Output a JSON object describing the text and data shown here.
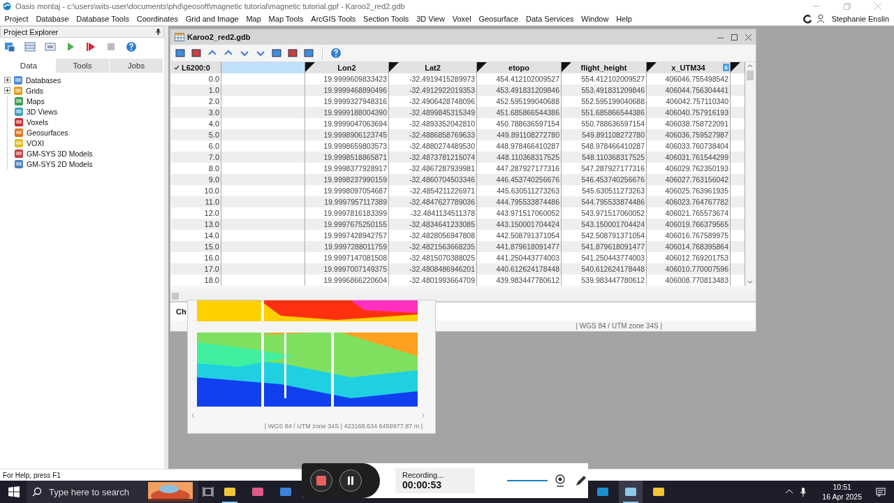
{
  "window": {
    "title": "Oasis montaj - c:\\users\\wits-user\\documents\\phd\\geosoft\\magnetic tutorial\\magnetic tutorial.gpf - Karoo2_red2.gdb"
  },
  "menu": [
    "Project",
    "Database",
    "Database Tools",
    "Coordinates",
    "Grid and Image",
    "Map",
    "Map Tools",
    "ArcGIS Tools",
    "Section Tools",
    "3D View",
    "Voxel",
    "Geosurface",
    "Data Services",
    "Window",
    "Help"
  ],
  "user": {
    "name": "Stephanie Enslin"
  },
  "explorer": {
    "title": "Project Explorer",
    "tabs": [
      {
        "label": "Data",
        "selected": true
      },
      {
        "label": "Tools",
        "selected": false
      },
      {
        "label": "Jobs",
        "selected": false
      }
    ],
    "items": [
      {
        "label": "Databases",
        "expandable": true
      },
      {
        "label": "Grids",
        "expandable": true
      },
      {
        "label": "Maps",
        "expandable": false
      },
      {
        "label": "3D Views",
        "expandable": false
      },
      {
        "label": "Voxels",
        "expandable": false
      },
      {
        "label": "Geosurfaces",
        "expandable": false
      },
      {
        "label": "VOXI",
        "expandable": false
      },
      {
        "label": "GM-SYS 3D Models",
        "expandable": false
      },
      {
        "label": "GM-SYS 2D Models",
        "expandable": false
      }
    ]
  },
  "database": {
    "title": "Karoo2_red2.gdb",
    "index_header": "L6200:0",
    "columns": [
      {
        "selected": true
      },
      {
        "label": "Lon2",
        "selected": false
      },
      {
        "label": "Lat2",
        "selected": false
      },
      {
        "label": "etopo",
        "selected": false
      },
      {
        "label": "flight_height",
        "selected": false
      },
      {
        "label": "x_UTM34",
        "selected": false
      }
    ],
    "rows": [
      {
        "index": "0.0",
        "values": [
          "19.9999609833423",
          "-32.4919415289973",
          "454.412102009527",
          "554.412102009527",
          "406046.755498542"
        ]
      },
      {
        "index": "1.0",
        "values": [
          "19.9999468890496",
          "-32.4912922019353",
          "453.491831209846",
          "553.491831209846",
          "406044.756304441"
        ]
      },
      {
        "index": "2.0",
        "values": [
          "19.9999327948316",
          "-32.4906428748096",
          "452.595199040688",
          "552.595199040688",
          "406042.757110340"
        ]
      },
      {
        "index": "3.0",
        "values": [
          "19.9999188004390",
          "-32.4899845315349",
          "451.685866544386",
          "551.685866544386",
          "406040.757916193"
        ]
      },
      {
        "index": "4.0",
        "values": [
          "19.9999047063694",
          "-32.4893352042810",
          "450.788636597154",
          "550.788636597154",
          "406038.758722091"
        ]
      },
      {
        "index": "5.0",
        "values": [
          "19.9998906123745",
          "-32.4886858769633",
          "449.891108272780",
          "549.891108272780",
          "406036.759527987"
        ]
      },
      {
        "index": "6.0",
        "values": [
          "19.9998659803573",
          "-32.4880274489530",
          "448.978466410287",
          "548.978466410287",
          "406033.760738404"
        ]
      },
      {
        "index": "7.0",
        "values": [
          "19.9998518865871",
          "-32.4873781215074",
          "448.110368317525",
          "548.110368317525",
          "406031.761544299"
        ]
      },
      {
        "index": "8.0",
        "values": [
          "19.9998377928917",
          "-32.4867287939981",
          "447.287927177316",
          "547.287927177316",
          "406029.762350193"
        ]
      },
      {
        "index": "9.0",
        "values": [
          "19.9998237990159",
          "-32.4860704503346",
          "446.453740256676",
          "546.453740256676",
          "406027.763156042"
        ]
      },
      {
        "index": "10.0",
        "values": [
          "19.9998097054687",
          "-32.4854211226971",
          "445.630511273263",
          "545.630511273263",
          "406025.763961935"
        ]
      },
      {
        "index": "11.0",
        "values": [
          "19.9997957117389",
          "-32.4847627789036",
          "444.795533874486",
          "544.795533874486",
          "406023.764767782"
        ]
      },
      {
        "index": "12.0",
        "values": [
          "19.9997816183399",
          "-32.4841134511378",
          "443.971517060052",
          "543.971517060052",
          "406021.765573674"
        ]
      },
      {
        "index": "13.0",
        "values": [
          "19.9997675250155",
          "-32.4834641233085",
          "443.150001704424",
          "543.150001704424",
          "406019.766379565"
        ]
      },
      {
        "index": "14.0",
        "values": [
          "19.9997428942757",
          "-32.4828056947808",
          "442.508791371054",
          "542.508791371054",
          "406016.767589975"
        ]
      },
      {
        "index": "15.0",
        "values": [
          "19.9997288011759",
          "-32.4821563668235",
          "441.879618091477",
          "541.879618091477",
          "406014.768395864"
        ]
      },
      {
        "index": "16.0",
        "values": [
          "19.9997147081508",
          "-32.4815070388025",
          "441.250443774003",
          "541.250443774003",
          "406012.769201753"
        ]
      },
      {
        "index": "17.0",
        "values": [
          "19.9997007149375",
          "-32.4808486946201",
          "440.612624178448",
          "540.612624178448",
          "406010.770007596"
        ]
      },
      {
        "index": "18.0",
        "values": [
          "19.9996866220604",
          "-32.4801993664709",
          "439.983447780612",
          "539.983447780612",
          "406008.770813483"
        ]
      }
    ],
    "chart_label": "Ch",
    "status": "| WGS 84 / UTM zone 34S |"
  },
  "map": {
    "status": "| WGS 84 / UTM zone 34S | 423168.634 6459977.87 m |"
  },
  "status_bar": "For Help, press F1",
  "recorder": {
    "state": "Recording...",
    "time": "00:00:53",
    "level": 1
  },
  "taskbar": {
    "search": {
      "placeholder": "Type here to search"
    },
    "apps": [
      {
        "open": true,
        "active": false
      },
      {
        "open": false,
        "active": false
      },
      {
        "open": false,
        "active": false
      },
      {
        "open": false,
        "active": false
      },
      {
        "open": true,
        "active": true
      },
      {
        "open": false,
        "active": false
      }
    ],
    "time": "10:51",
    "date": "16 Apr 2025"
  }
}
